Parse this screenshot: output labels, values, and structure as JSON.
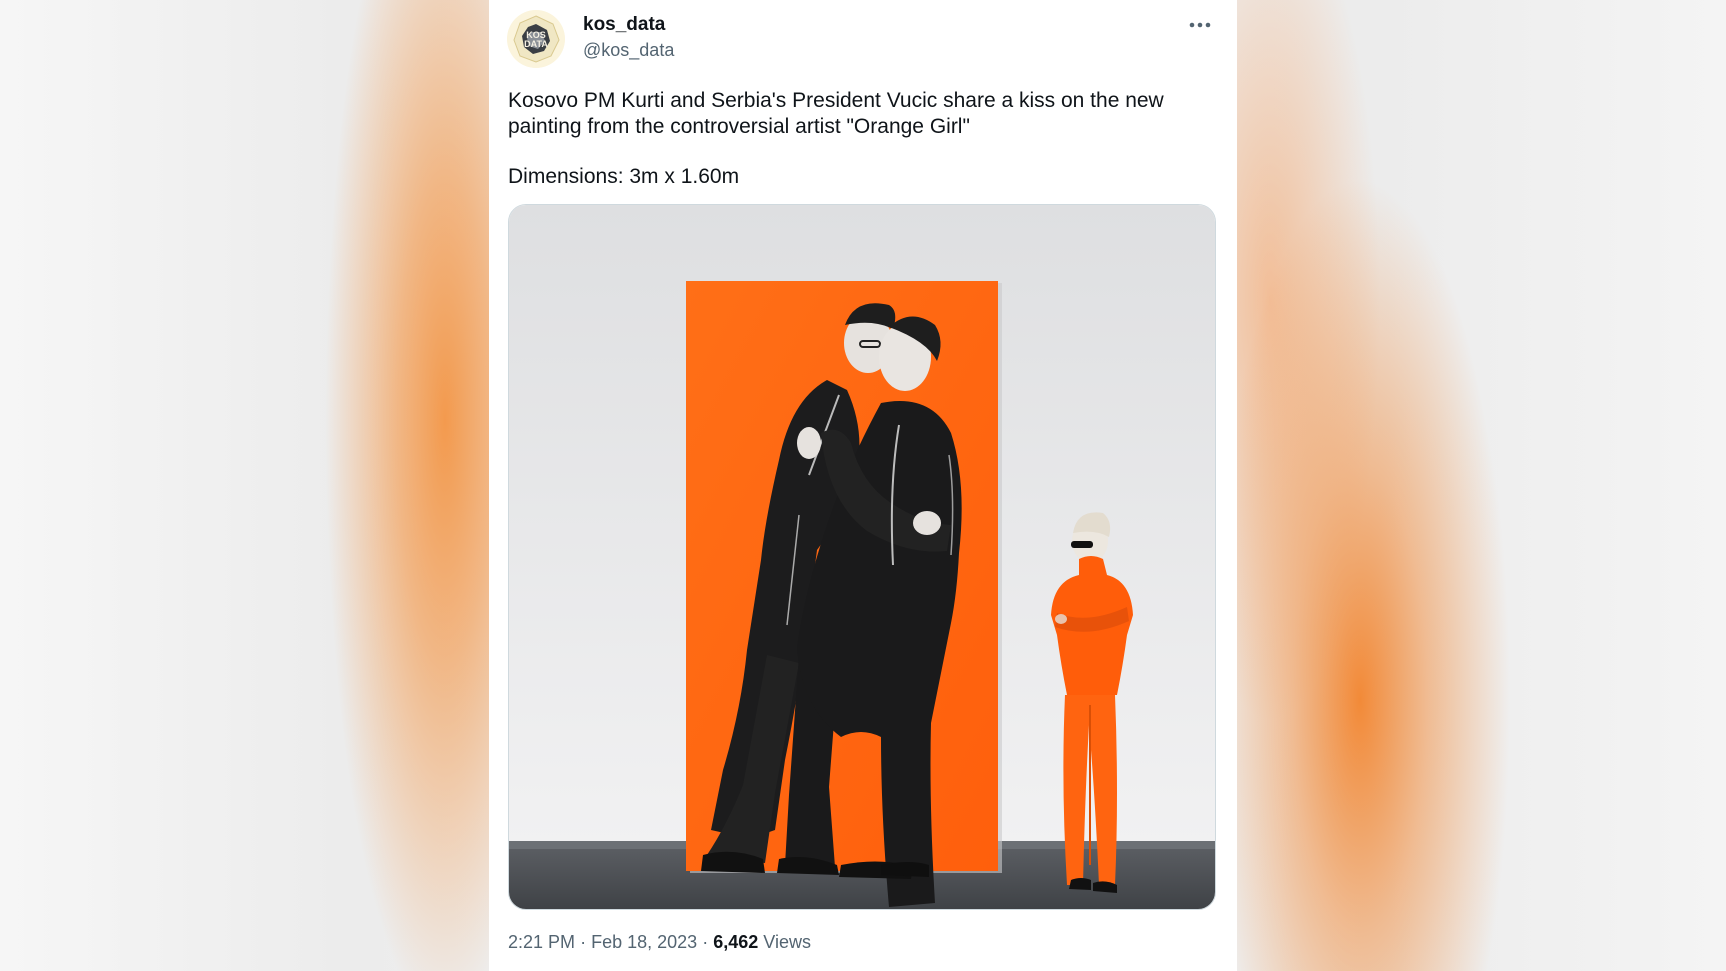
{
  "tweet": {
    "author": {
      "name": "kos_data",
      "handle": "@kos_data",
      "avatar_text_line1": "KOS",
      "avatar_text_line2": "DATA"
    },
    "text_paragraph_1": "Kosovo PM Kurti and Serbia's President Vucic share a kiss on the new painting from the controversial artist \"Orange Girl\"",
    "text_paragraph_2": "Dimensions: 3m x 1.60m",
    "media": {
      "icon": "photo-painting-orange",
      "painting_color": "#ff6a13",
      "wall_color": "#e9e9ea",
      "floor_color": "#4a4d52"
    },
    "meta": {
      "time": "2:21 PM",
      "separator": "·",
      "date": "Feb 18, 2023",
      "views_count": "6,462",
      "views_label": "Views"
    },
    "more_icon": "more-horizontal-icon"
  }
}
